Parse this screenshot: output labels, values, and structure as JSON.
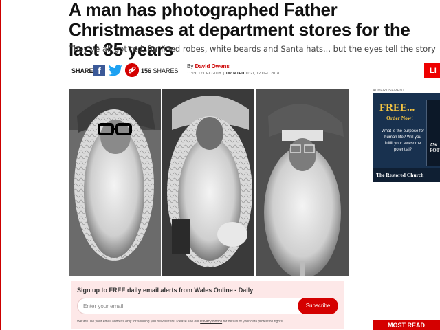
{
  "article": {
    "headline": "A man has photographed Father Christmases at department stores for the last 35 years",
    "standfirst": "They've all got red, fur-lined robes, white beards and Santa hats... but the eyes tell the story"
  },
  "share": {
    "label": "SHARE",
    "count": "156",
    "count_label": "SHARES"
  },
  "byline": {
    "prefix": "By",
    "author": "David Owens",
    "published": "11:19, 12 DEC 2018",
    "updated_label": "UPDATED",
    "updated": "11:21, 12 DEC 2018"
  },
  "live_button": {
    "label": "LI"
  },
  "signup": {
    "title": "Sign up to FREE daily email alerts from Wales Online - Daily",
    "email_placeholder": "Enter your email",
    "subscribe_label": "Subscribe",
    "privacy_before": "We will use your email address only for sending you newsletters. Please see our",
    "privacy_link": "Privacy Notice",
    "privacy_after": "for details of your data protection rights"
  },
  "ad": {
    "label": "ADVERTISEMENT",
    "free": "FREE...",
    "order": "Order Now!",
    "body": "What is the purpose for human life? Will you fulfill your awesome potential?",
    "book_title": "AW POT",
    "footer": "The Restored Church"
  },
  "most_read": {
    "label": "MOST READ"
  },
  "colors": {
    "accent": "#d40000",
    "facebook": "#3b5998",
    "twitter": "#1da1f2"
  }
}
